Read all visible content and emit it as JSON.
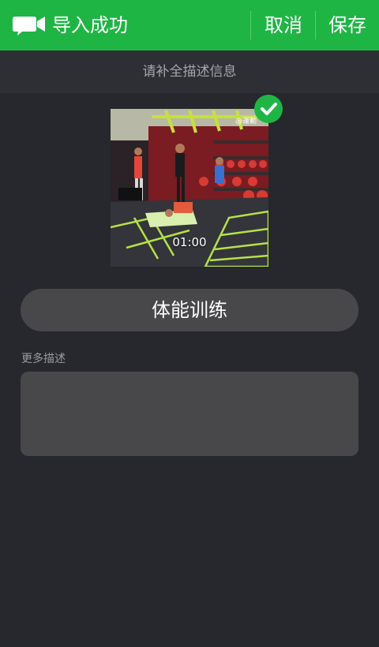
{
  "header": {
    "title": "导入成功",
    "cancel_label": "取消",
    "save_label": "保存",
    "logo_icon": "video-chat-icon",
    "accent_color": "#1fb545"
  },
  "subheader": {
    "text": "请补全描述信息"
  },
  "video": {
    "duration": "01:00",
    "watermark": "@運動",
    "selected_icon": "check-icon"
  },
  "form": {
    "title_value": "体能训练",
    "description_label": "更多描述",
    "description_value": ""
  }
}
